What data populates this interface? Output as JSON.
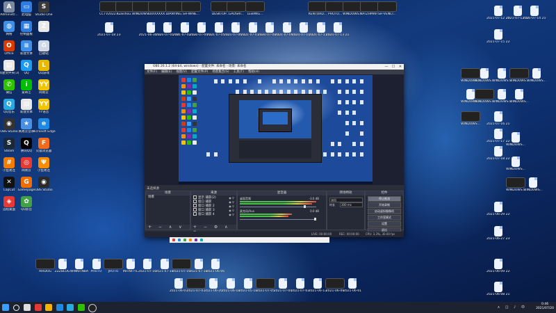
{
  "desktop": {
    "left_icons": [
      {
        "id": "admin",
        "label": "Administr...",
        "color": "#7a8aa0",
        "glyph": "A"
      },
      {
        "id": "thispc",
        "label": "此电脑",
        "color": "#2f7de0",
        "glyph": "▭"
      },
      {
        "id": "studio",
        "label": "Studio One",
        "color": "#3a3a3a",
        "glyph": "S"
      },
      {
        "id": "network",
        "label": "网络",
        "color": "#3d8fe8",
        "glyph": "◍"
      },
      {
        "id": "control",
        "label": "控制面板",
        "color": "#2f7de0",
        "glyph": "▦"
      },
      {
        "id": "s2",
        "label": "",
        "color": "#e8e8e8",
        "glyph": "Z"
      },
      {
        "id": "office",
        "label": "Office",
        "color": "#d83b01",
        "glyph": "O"
      },
      {
        "id": "newdoc",
        "label": "新建文本",
        "color": "#3d8fe8",
        "glyph": "≡"
      },
      {
        "id": "recycle",
        "label": "回收站",
        "color": "#cfd8e6",
        "glyph": "♻"
      },
      {
        "id": "newfolder",
        "label": "新建文件夹(3)",
        "color": "#e8e8e8",
        "glyph": "▤"
      },
      {
        "id": "qq",
        "label": "QQ",
        "color": "#1d9bf0",
        "glyph": "Q"
      },
      {
        "id": "l",
        "label": "QQ游戏",
        "color": "#e9b800",
        "glyph": "L"
      },
      {
        "id": "wechat",
        "label": "微信",
        "color": "#2dc100",
        "glyph": "✆"
      },
      {
        "id": "iqiyi",
        "label": "爱奇艺",
        "color": "#00be06",
        "glyph": "i"
      },
      {
        "id": "yy",
        "label": "网易云",
        "color": "#f5c400",
        "glyph": "YY"
      },
      {
        "id": "qqmusic",
        "label": "QQ音乐",
        "color": "#2aa9e0",
        "glyph": "Q"
      },
      {
        "id": "newfile",
        "label": "新建文本",
        "color": "#e8e8e8",
        "glyph": "▤"
      },
      {
        "id": "yy2",
        "label": "YY语音",
        "color": "#f5c400",
        "glyph": "YY"
      },
      {
        "id": "obsicon",
        "label": "OBS Studio",
        "color": "#333",
        "glyph": "◉"
      },
      {
        "id": "star",
        "label": "网易云音乐",
        "color": "#4a90e2",
        "glyph": "★"
      },
      {
        "id": "edge",
        "label": "Microsoft Edge",
        "color": "#1e88e5",
        "glyph": "e"
      },
      {
        "id": "steam",
        "label": "Steam",
        "color": "#1b2838",
        "glyph": "S"
      },
      {
        "id": "qqgame",
        "label": "腾讯QQ",
        "color": "#000",
        "glyph": "Q"
      },
      {
        "id": "fox",
        "label": "火狐浏览器",
        "color": "#f26a1b",
        "glyph": "F"
      },
      {
        "id": "app1",
        "label": "小鱼易连",
        "color": "#f57c00",
        "glyph": "#"
      },
      {
        "id": "netease",
        "label": "网易云",
        "color": "#e53935",
        "glyph": "◎"
      },
      {
        "id": "app2",
        "label": "小鱼易连",
        "color": "#fb8c00",
        "glyph": "Ψ"
      },
      {
        "id": "cx",
        "label": "CapCut",
        "color": "#111",
        "glyph": "✕"
      },
      {
        "id": "gicon",
        "label": "Gamepage",
        "color": "#ef6c00",
        "glyph": "G"
      },
      {
        "id": "obs2",
        "label": "OBS Studio",
        "color": "#2a2a2a",
        "glyph": "◉"
      },
      {
        "id": "share",
        "label": "远程桌面",
        "color": "#e53935",
        "glyph": "◈"
      },
      {
        "id": "ccw",
        "label": "QQ影音",
        "color": "#43a047",
        "glyph": "✿"
      }
    ],
    "top_thumbs": [
      "CCTV2022...",
      "Kuaishou...",
      "WINDOWS...",
      "XXXXXXXX...",
      "DIANYING...",
      "SH-WINE...",
      "DESKTOP...",
      "GAOSHI...",
      "LEBANG...",
      "KENTORD...",
      "PHOTO...",
      "WINDOWS...",
      "NATZHMAP...",
      "SH-VENCI..."
    ],
    "file_labels": [
      "2021-07-18 23-17-44...",
      "2021-06-30 22-04-09...",
      "2021-07-01 00-05-36...",
      "2021-07-02 23-08-58...",
      "2021-07-04 21-42-53...",
      "2021-07-05 21-44-25...",
      "2021-07-06 21-55-43...",
      "2021-07-07 23-12-55...",
      "2021-07-08 21-57-55...",
      "2021-07-09 22-10-07...",
      "2021-07-10 21-46-16...",
      "2021-07-11 22-04-05...",
      "2021-07-13 21-18-34..."
    ],
    "right_labels": [
      "2021-07-12 21-56-05...",
      "2021-07-13 22-15-37...",
      "2021-07-14 21-57-13...",
      "2021-07-15 22-19-46...",
      "2021-07-16 21-44-33...",
      "2021-07-17 22-18-02...",
      "2021-07-18 22-23-41...",
      "2021-06-29 22-44-12...",
      "2021-06-27 23-04-05...",
      "2021-06-09 22-07-52...",
      "2021-06-08 21-55-16..."
    ],
    "bottom_labels": [
      "AIRDOG",
      "ZZZBLOG",
      "WINNITNBA",
      "PHOTO",
      "JHOTO",
      "INFINITYL",
      "2021-07-16",
      "2021-07-18",
      "2021-07-16",
      "2021-07-18",
      "2021-06-06",
      "2021-06-07",
      "2021-07-07",
      "2021-06-20",
      "2021-06-18",
      "2021-05-18",
      "2021-07-05",
      "2021-07-04",
      "2021-07-03",
      "2021-06-13",
      "2021-06-09",
      "2021-06-01"
    ]
  },
  "obs": {
    "title": "OBS 26.1.2 (64-bit, windows) - 配置文件: 未命名 - 场景: 未命名",
    "menu": [
      "文件(F)",
      "编辑(E)",
      "视图(V)",
      "配置文件(P)",
      "场景集合(S)",
      "工具(T)",
      "帮助(H)"
    ],
    "min_label": "—",
    "max_label": "☐",
    "close_label": "✕",
    "scene_label": "未选择源",
    "docks": {
      "scenes": {
        "title": "场景",
        "items": [
          "场景"
        ],
        "footer": "+ − ∧ ∨"
      },
      "sources": {
        "title": "来源",
        "items": [
          "显示 捕获(2)",
          "窗口 捕获",
          "窗口 捕获 2",
          "窗口 捕获 3",
          "窗口 捕获 4"
        ],
        "footer": "+ − ⚙ ∧ ∨"
      },
      "mixer": {
        "title": "混音器",
        "channels": [
          {
            "name": "桌面音频",
            "db": "-3.0 dB"
          },
          {
            "name": "麦克风/Aux",
            "db": "0.0 dB"
          }
        ]
      },
      "transitions": {
        "title": "转场特效",
        "type_label": "淡出",
        "duration_label": "时长",
        "duration_value": "300 ms"
      },
      "controls": {
        "title": "控件",
        "buttons": [
          "停止推流",
          "开始录制",
          "启动虚拟摄像机",
          "工作室模式",
          "设置",
          "退出"
        ]
      }
    },
    "status": {
      "live": "LIVE: 00:00:00",
      "rec": "REC: 00:00:00",
      "cpu": "CPU: 3.3%, 30.00 fps",
      "kbps": "kb/s: 0"
    }
  },
  "taskbar": {
    "time": "0:46",
    "date": "2021/07/20",
    "tray_glyphs": "∧ ◫ ♪ 中",
    "apps": [
      {
        "id": "start",
        "color": "#3aa0ff"
      },
      {
        "id": "search",
        "color": "#ffffff"
      },
      {
        "id": "taskview",
        "color": "#dddddd"
      },
      {
        "id": "chrome",
        "color": "#e53935"
      },
      {
        "id": "explorer",
        "color": "#f5b400"
      },
      {
        "id": "edge",
        "color": "#1e88e5"
      },
      {
        "id": "qqapp",
        "color": "#2aa9e0"
      },
      {
        "id": "wechatapp",
        "color": "#2dc100"
      },
      {
        "id": "obsapp",
        "color": "#888888"
      }
    ]
  }
}
